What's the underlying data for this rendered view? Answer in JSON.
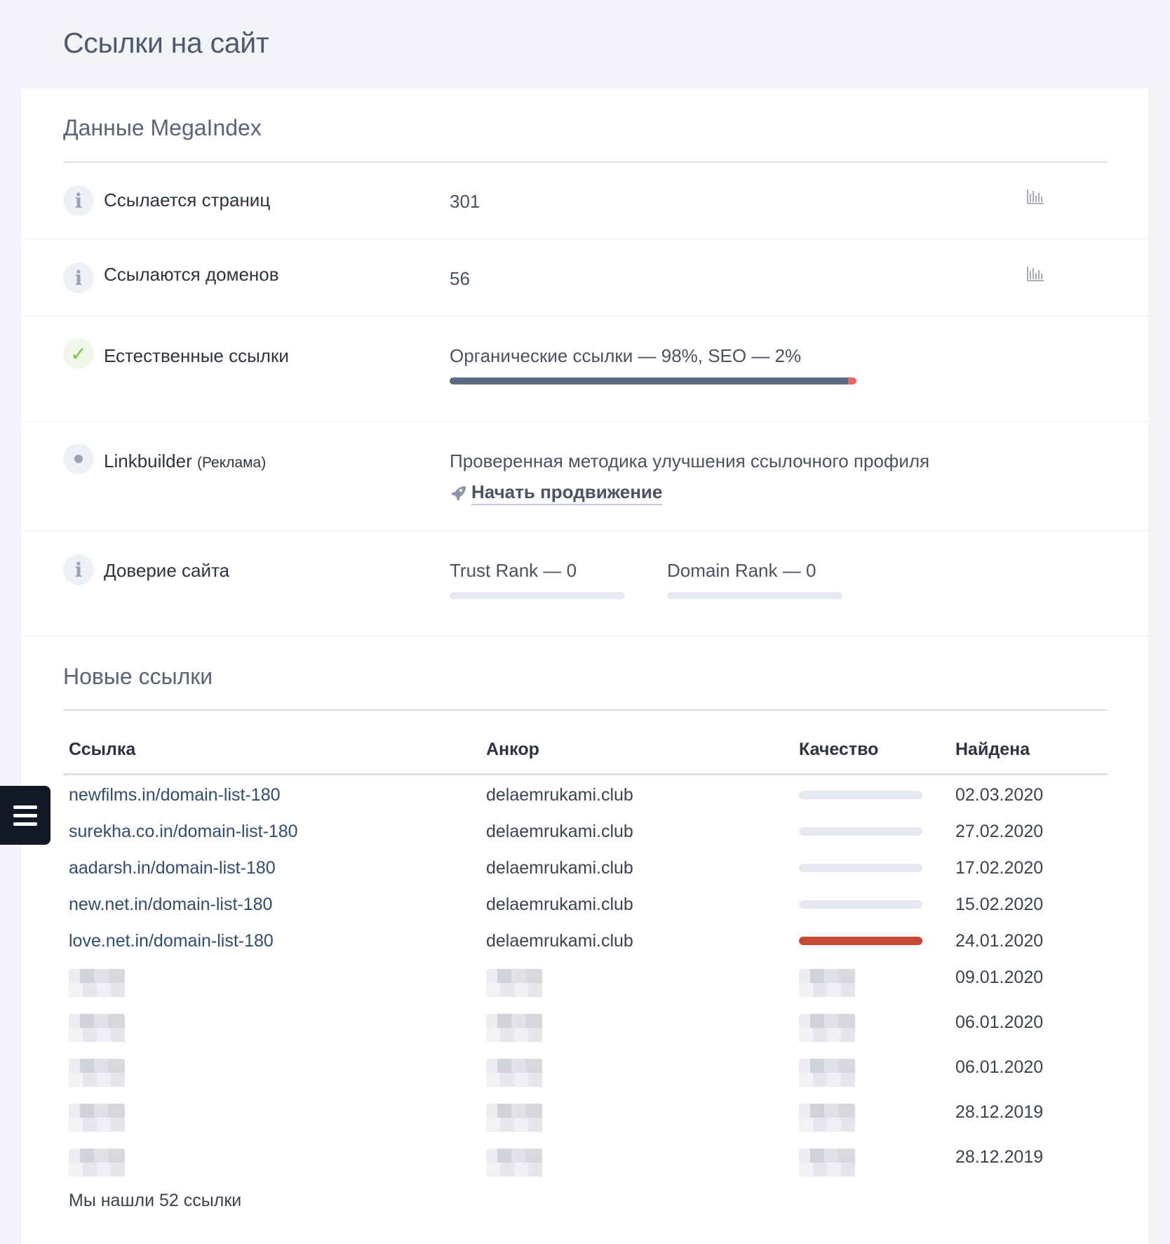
{
  "page": {
    "title": "Ссылки на сайт"
  },
  "megaindex": {
    "title": "Данные MegaIndex",
    "pages": {
      "label": "Ссылается страниц",
      "value": "301"
    },
    "domains": {
      "label": "Ссылаются доменов",
      "value": "56"
    },
    "natural": {
      "label": "Естественные ссылки",
      "text": "Органические ссылки — 98%, SEO — 2%",
      "organic_percent": 98,
      "seo_percent": 2
    },
    "linkbuilder": {
      "label": "Linkbuilder",
      "label_note": "(Реклама)",
      "text": "Проверенная методика улучшения ссылочного профиля",
      "cta": "Начать продвижение"
    },
    "trust": {
      "label": "Доверие сайта",
      "trust_rank": "Trust Rank — 0",
      "trust_rank_value": 0,
      "domain_rank": "Domain Rank — 0",
      "domain_rank_value": 0
    }
  },
  "new_links": {
    "title": "Новые ссылки",
    "columns": [
      "Ссылка",
      "Анкор",
      "Качество",
      "Найдена"
    ],
    "rows": [
      {
        "link": "newfilms.in/domain-list-180",
        "anchor": "delaemrukami.club",
        "quality": "low",
        "date": "02.03.2020"
      },
      {
        "link": "surekha.co.in/domain-list-180",
        "anchor": "delaemrukami.club",
        "quality": "low",
        "date": "27.02.2020"
      },
      {
        "link": "aadarsh.in/domain-list-180",
        "anchor": "delaemrukami.club",
        "quality": "low",
        "date": "17.02.2020"
      },
      {
        "link": "new.net.in/domain-list-180",
        "anchor": "delaemrukami.club",
        "quality": "low",
        "date": "15.02.2020"
      },
      {
        "link": "love.net.in/domain-list-180",
        "anchor": "delaemrukami.club",
        "quality": "bad",
        "date": "24.01.2020"
      }
    ],
    "hidden_dates": [
      "09.01.2020",
      "06.01.2020",
      "06.01.2020",
      "28.12.2019",
      "28.12.2019"
    ],
    "footer": "Мы нашли 52 ссылки"
  },
  "colors": {
    "organic": "#5b6b83",
    "seo": "#f0655b",
    "quality_bad": "#c54a36",
    "link": "#2f4c73",
    "check": "#7cc444"
  }
}
